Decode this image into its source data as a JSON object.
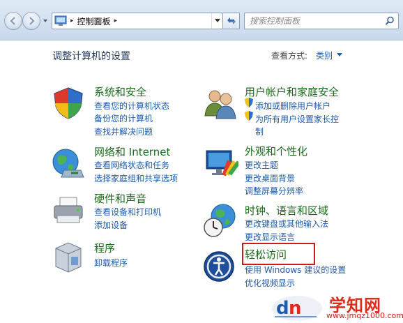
{
  "address_bar": {
    "separator": "▸",
    "crumb": "控制面板",
    "crumb_sep": "▸"
  },
  "search": {
    "placeholder": "搜索控制面板"
  },
  "page_title": "调整计算机的设置",
  "view_by": {
    "label": "查看方式:",
    "value": "类别"
  },
  "categories": {
    "security": {
      "title": "系统和安全",
      "links": [
        "查看您的计算机状态",
        "备份您的计算机",
        "查找并解决问题"
      ]
    },
    "network": {
      "title": "网络和 Internet",
      "links": [
        "查看网络状态和任务",
        "选择家庭组和共享选项"
      ]
    },
    "hardware": {
      "title": "硬件和声音",
      "links": [
        "查看设备和打印机",
        "添加设备"
      ]
    },
    "programs": {
      "title": "程序",
      "links": [
        "卸载程序"
      ]
    },
    "users": {
      "title": "用户帐户和家庭安全",
      "links": [
        "添加或删除用户帐户",
        "为所有用户设置家长控",
        "制"
      ]
    },
    "appearance": {
      "title": "外观和个性化",
      "links": [
        "更改主题",
        "更改桌面背景",
        "调整屏幕分辨率"
      ]
    },
    "clock": {
      "title": "时钟、语言和区域",
      "links": [
        "更改键盘或其他输入法",
        "更改显示语言"
      ]
    },
    "ease": {
      "title": "轻松访问",
      "links": [
        "使用 Windows 建议的设置",
        "优化视频显示"
      ]
    }
  },
  "watermark": {
    "title": "学知网",
    "url": "www.jmqz1000.com"
  },
  "colors": {
    "category_title": "#1a6a1a",
    "link": "#1e5bab",
    "highlight": "#cc1a1a"
  }
}
